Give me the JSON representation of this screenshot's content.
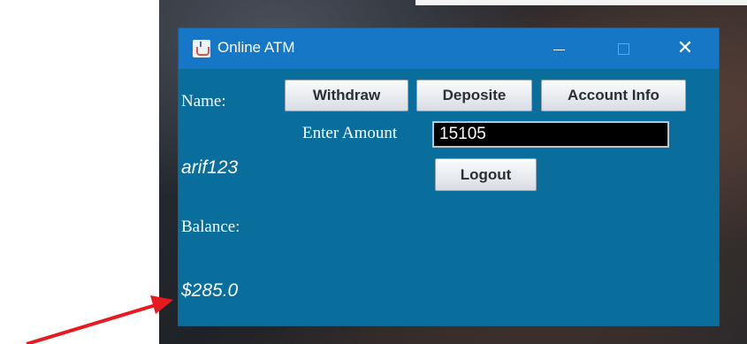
{
  "window": {
    "title": "Online ATM",
    "close_glyph": "✕"
  },
  "labels": {
    "name": "Name:",
    "username": "arif123",
    "balance": "Balance:",
    "balance_value": "$285.0",
    "enter_amount": "Enter Amount"
  },
  "buttons": {
    "withdraw": "Withdraw",
    "deposite": "Deposite",
    "account_info": "Account Info",
    "logout": "Logout"
  },
  "amount_input": {
    "value": "15105"
  },
  "colors": {
    "title_bar": "#1677c7",
    "window_body": "#0a6e9c",
    "annotation_arrow": "#e8191f"
  },
  "icons": [
    "java-cup-icon",
    "minimize-icon",
    "maximize-icon",
    "close-icon",
    "red-arrow"
  ]
}
